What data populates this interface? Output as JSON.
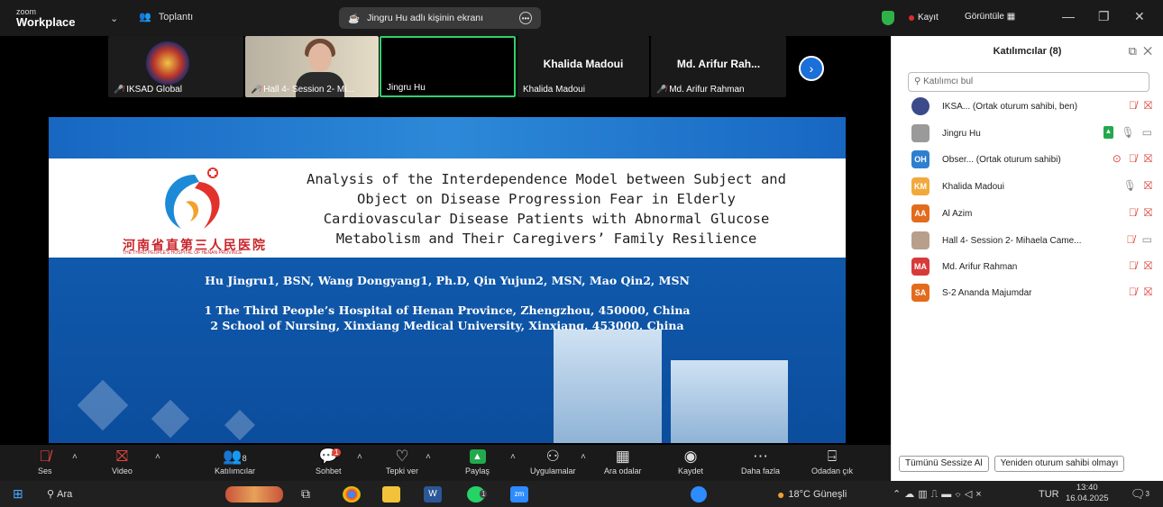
{
  "titlebar": {
    "brand_top": "zoom",
    "brand_bottom": "Workplace",
    "meeting_label": "Toplantı",
    "share_label": "Jingru Hu adlı kişinin ekranı",
    "record_label": "Kayıt",
    "view_label": "Görüntüle"
  },
  "video_strip": {
    "tiles": [
      {
        "name": "IKSAD Global",
        "muted": true
      },
      {
        "name": "Hall 4- Session 2- Mi...",
        "muted": true
      },
      {
        "name": "Jingru Hu",
        "muted": false
      },
      {
        "name": "Khalida Madoui",
        "display": "Khalida Madoui",
        "muted": false
      },
      {
        "name": "Md. Arifur Rahman",
        "display": "Md. Arifur Rah...",
        "muted": true
      }
    ]
  },
  "slide": {
    "chinese_logo_text": "河南省直第三人民医院",
    "logo_subtitle": "THE THIRD PEOPLE'S HOSPITAL OF HENAN PROVINCE",
    "title_lines": [
      "Analysis of the Interdependence Model between Subject and",
      "Object on Disease Progression Fear in Elderly",
      "Cardiovascular Disease Patients with Abnormal Glucose",
      "Metabolism and Their Caregivers’ Family Resilience"
    ],
    "authors": "Hu Jingru1, BSN,  Wang Dongyang1, Ph.D, Qin Yujun2, MSN, Mao Qin2, MSN",
    "affiliation_1": "1 The Third People’s Hospital of Henan Province, Zhengzhou, 450000, China",
    "affiliation_2": "2 School of Nursing, Xinxiang Medical University, Xinxiang, 453000, China"
  },
  "toolbar": {
    "audio": "Ses",
    "video": "Video",
    "participants": "Katılımcılar",
    "participants_count": "8",
    "chat": "Sohbet",
    "chat_badge": "1",
    "reactions": "Tepki ver",
    "share": "Paylaş",
    "apps": "Uygulamalar",
    "breakout": "Ara odalar",
    "record": "Kaydet",
    "more": "Daha fazla",
    "leave": "Odadan çık"
  },
  "panel": {
    "title": "Katılımcılar (8)",
    "search_placeholder": "Katılımcı bul",
    "participants": [
      {
        "initials": "",
        "name": "IKSA...  (Ortak oturum sahibi, ben)",
        "color": "#3a4a8a"
      },
      {
        "initials": "",
        "name": "Jingru Hu",
        "color": "#9a9a9a"
      },
      {
        "initials": "OH",
        "name": "Obser... (Ortak oturum sahibi)",
        "color": "#2f7fd0"
      },
      {
        "initials": "KM",
        "name": "Khalida Madoui",
        "color": "#f2a93b"
      },
      {
        "initials": "AA",
        "name": "Al Azim",
        "color": "#e36b1e"
      },
      {
        "initials": "",
        "name": "Hall 4- Session 2- Mihaela Came...",
        "color": "#b89f8c"
      },
      {
        "initials": "MA",
        "name": "Md. Arifur Rahman",
        "color": "#d83a3a"
      },
      {
        "initials": "SA",
        "name": "S-2 Ananda Majumdar",
        "color": "#e36b1e"
      }
    ],
    "mute_all": "Tümünü Sessize Al",
    "reclaim_host": "Yeniden oturum sahibi olmayı"
  },
  "taskbar": {
    "search": "Ara",
    "chat_badge": "1",
    "weather": "18°C  Güneşli",
    "language": "TUR",
    "time": "13:40",
    "date": "16.04.2025",
    "notification_count": "3"
  },
  "colors": {
    "accent_blue": "#1b6fd8",
    "muted_red": "#e0473e",
    "share_green": "#22a94b"
  }
}
